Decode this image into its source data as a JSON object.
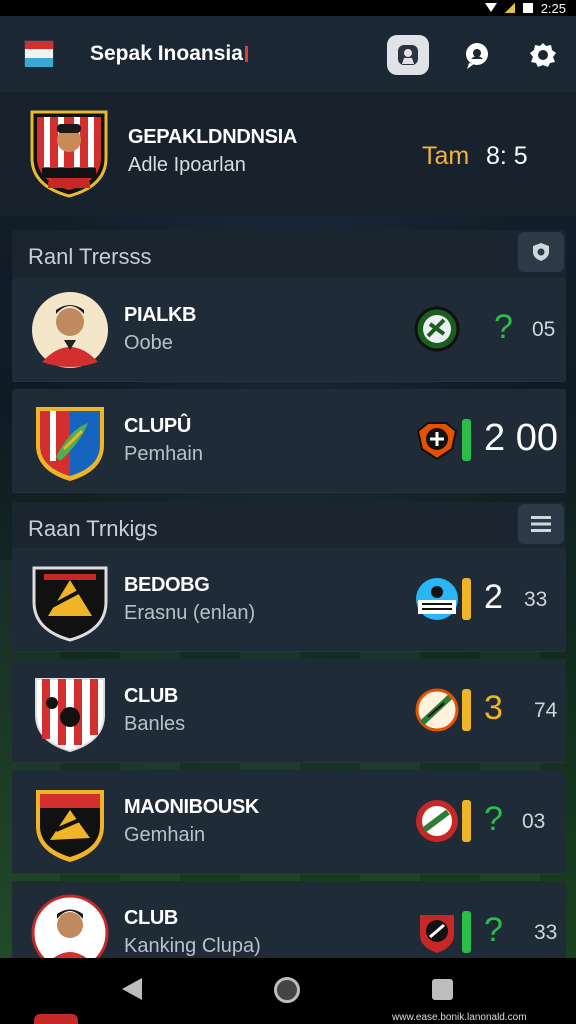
{
  "status_bar": {
    "time": "2:25"
  },
  "app_bar": {
    "title": "Sepak Inoansia",
    "icons": [
      "indonesia-flag-icon",
      "profile-icon",
      "chat-icon",
      "settings-icon"
    ]
  },
  "header": {
    "title": "GEPAKLDNDNSIA",
    "subtitle": "Adle Ipoarlan",
    "time_label": "Tam",
    "time_value": "8: 5"
  },
  "sections": [
    {
      "title": "Ranl Trersss",
      "action_icon": "shield-icon"
    },
    {
      "title": "Raan Trnkigs",
      "action_icon": "menu-icon"
    }
  ],
  "rows": [
    {
      "name": "PIALKB",
      "sub": "Oobe",
      "avatar": "player-photo",
      "logo": "green-club-logo-icon",
      "bar_color": "#2bbf4a",
      "score": "?",
      "extra": "05"
    },
    {
      "name": "CLUPÛ",
      "sub": "Pemhain",
      "avatar": "club-crest",
      "logo": "red-club-logo-icon",
      "bar_color": "#2bbf4a",
      "score": "2 00",
      "extra": ""
    },
    {
      "name": "BEDOBG",
      "sub": "Erasnu (enlan)",
      "avatar": "black-crest",
      "logo": "blue-club-logo-icon",
      "bar_color": "#f0b429",
      "score": "2",
      "extra": "33"
    },
    {
      "name": "CLUB",
      "sub": "Banles",
      "avatar": "striped-crest",
      "logo": "orange-club-logo-icon",
      "bar_color": "#f0b429",
      "score": "3",
      "extra": "74"
    },
    {
      "name": "MAONIBOUSK",
      "sub": "Gemhain",
      "avatar": "red-black-crest",
      "logo": "red-green-club-logo-icon",
      "bar_color": "#f0b429",
      "score": "?",
      "extra": "03"
    },
    {
      "name": "CLUB",
      "sub": "Kanking Clupa)",
      "avatar": "player-photo",
      "logo": "red-white-club-logo-icon",
      "bar_color": "#2bbf4a",
      "score": "?",
      "extra": "33"
    }
  ],
  "nav_bar": {
    "buttons": [
      "back-icon",
      "home-icon",
      "recent-apps-icon"
    ]
  },
  "watermark": "www.ease.bonik.lanonald.com",
  "colors": {
    "accent": "#29b6f6",
    "time_label": "#f2b33d",
    "green": "#2bbf4a",
    "yellow": "#f0b429"
  }
}
